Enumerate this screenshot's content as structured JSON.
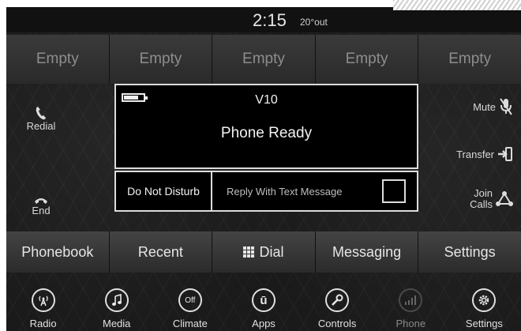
{
  "status": {
    "time": "2:15",
    "temp": "20°out"
  },
  "favorites": [
    "Empty",
    "Empty",
    "Empty",
    "Empty",
    "Empty"
  ],
  "left_actions": {
    "redial": "Redial",
    "end": "End"
  },
  "right_actions": {
    "mute": "Mute",
    "transfer": "Transfer",
    "join_calls": "Join Calls"
  },
  "panel": {
    "device": "V10",
    "status": "Phone Ready"
  },
  "options": {
    "dnd": "Do Not Disturb",
    "reply": "Reply With Text Message"
  },
  "tabs": {
    "phonebook": "Phonebook",
    "recent": "Recent",
    "dial": "Dial",
    "messaging": "Messaging",
    "settings": "Settings"
  },
  "nav": {
    "radio": "Radio",
    "media": "Media",
    "climate": "Climate",
    "apps": "Apps",
    "controls": "Controls",
    "phone": "Phone",
    "settings": "Settings"
  },
  "icons": {
    "climate_badge": "Off",
    "apps_badge": "ū"
  }
}
